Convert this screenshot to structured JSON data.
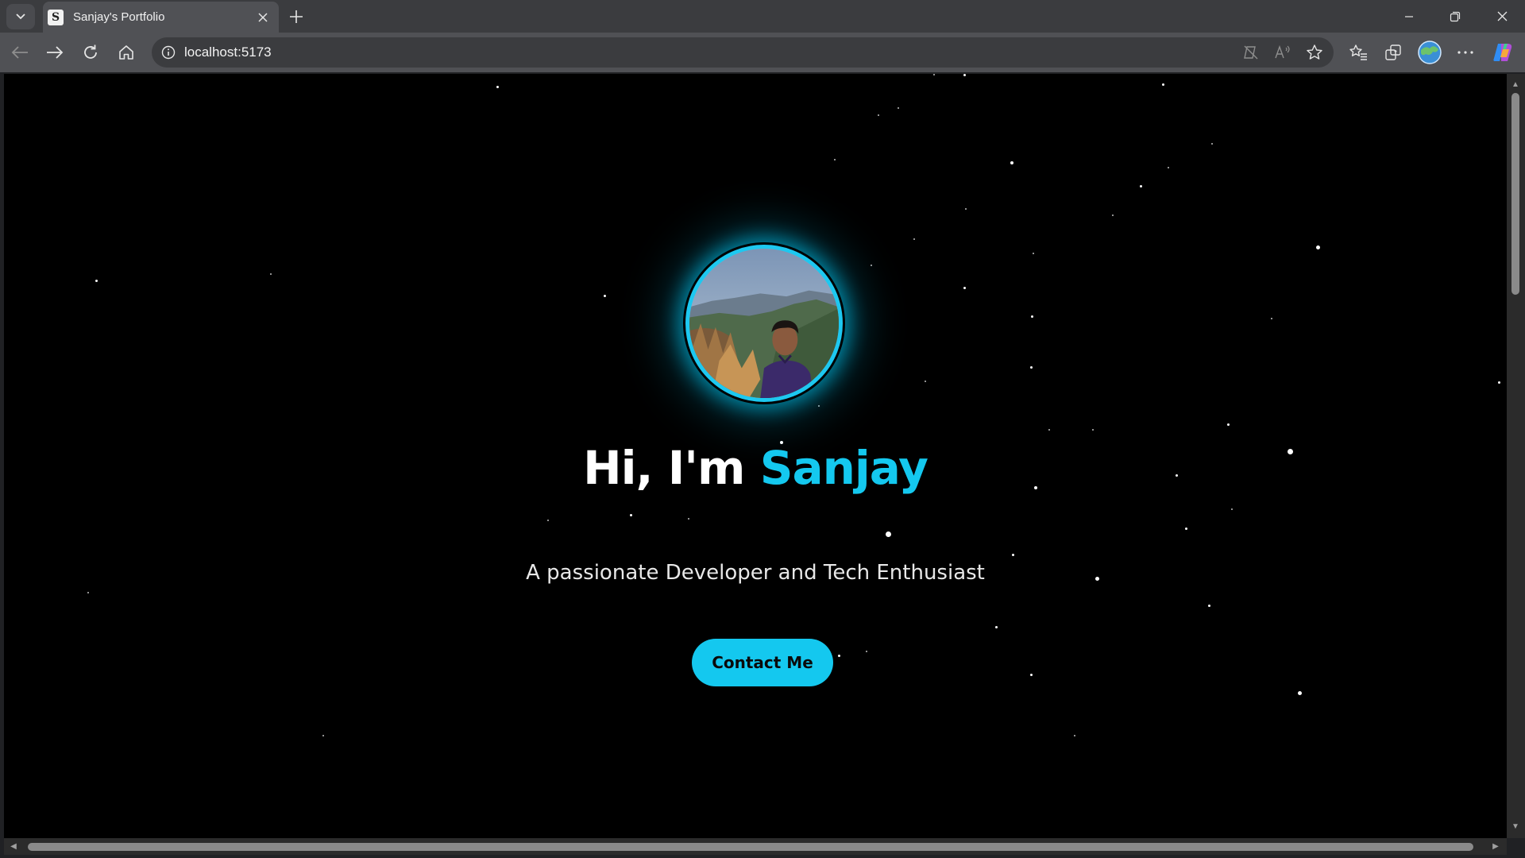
{
  "browser": {
    "tab_title": "Sanjay's Portfolio",
    "favicon_glyph": "S",
    "url": "localhost:5173"
  },
  "hero": {
    "greeting": "Hi, I'm ",
    "name": "Sanjay",
    "subtitle": "A passionate Developer and Tech Enthusiast",
    "cta_label": "Contact Me",
    "accent_color": "#14c8ef"
  },
  "icons": {
    "tab_menu": "chevron-down-icon",
    "tab_close": "close-icon",
    "new_tab": "plus-icon",
    "back": "arrow-left-icon",
    "forward": "arrow-right-icon",
    "reload": "reload-icon",
    "home": "home-icon",
    "site_info": "info-icon",
    "copilot": "copilot-icon"
  }
}
